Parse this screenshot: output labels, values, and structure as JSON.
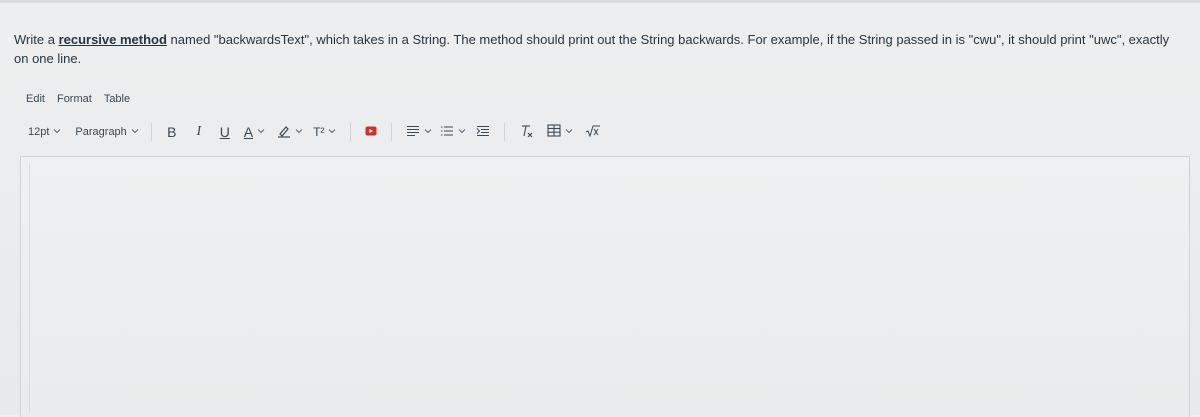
{
  "question": {
    "prefix": "Write a ",
    "link": "recursive method",
    "suffix": " named \"backwardsText\", which takes in a String. The method should print out the String backwards. For example, if the String passed in is \"cwu\", it should print \"uwc\", exactly on one line."
  },
  "menubar": {
    "items": [
      "Edit",
      "Format",
      "Table"
    ]
  },
  "toolbar": {
    "font_size": "12pt",
    "block_format": "Paragraph",
    "bold": "B",
    "italic": "I",
    "underline": "U",
    "text_color": "A",
    "superscript": "T²",
    "media_color": "#d22f2f",
    "icons": [
      "bold-icon",
      "italic-icon",
      "underline-icon",
      "text-color-icon",
      "highlight-icon",
      "superscript-icon",
      "media-icon",
      "align-icon",
      "list-icon",
      "indent-icon",
      "clear-format-icon",
      "table-icon",
      "equation-icon"
    ]
  },
  "editor": {
    "content": ""
  }
}
